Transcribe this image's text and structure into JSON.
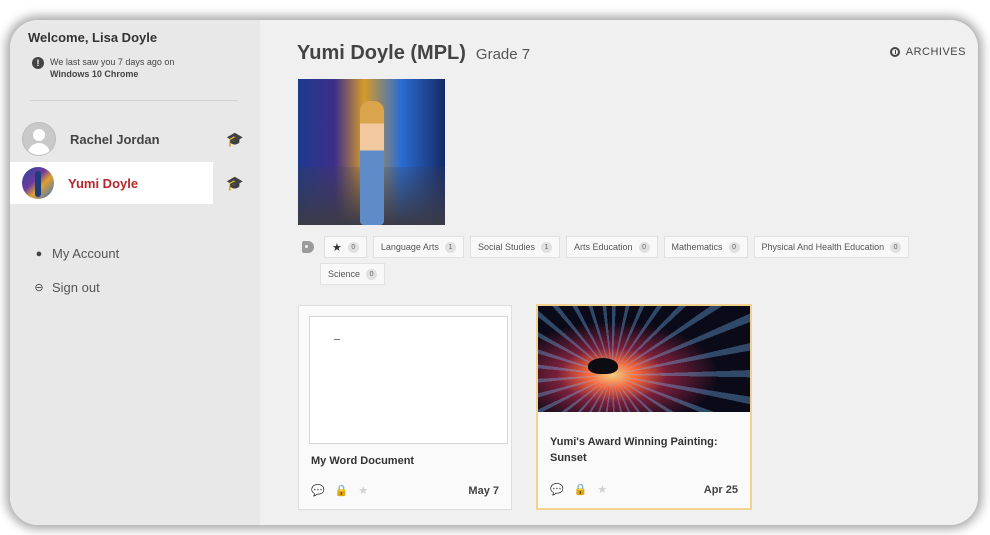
{
  "sidebar": {
    "welcome": "Welcome, Lisa Doyle",
    "last_seen_line1": "We last saw you 7 days ago on",
    "last_seen_line2": "Windows 10 Chrome",
    "students": [
      {
        "name": "Rachel Jordan",
        "icon": "graduation-cap-icon"
      },
      {
        "name": "Yumi Doyle",
        "icon": "graduation-cap-icon",
        "selected": true
      }
    ],
    "menu": [
      {
        "label": "My Account",
        "icon": "user-icon"
      },
      {
        "label": "Sign out",
        "icon": "sign-out-icon"
      }
    ]
  },
  "main": {
    "student_name": "Yumi Doyle (MPL)",
    "grade": "Grade 7",
    "archives_label": "ARCHIVES",
    "tags": [
      {
        "label": "★",
        "count": "0"
      },
      {
        "label": "Language Arts",
        "count": "1"
      },
      {
        "label": "Social Studies",
        "count": "1"
      },
      {
        "label": "Arts Education",
        "count": "0"
      },
      {
        "label": "Mathematics",
        "count": "0"
      },
      {
        "label": "Physical And Health Education",
        "count": "0"
      },
      {
        "label": "Science",
        "count": "0"
      }
    ],
    "cards": [
      {
        "title": "My Word Document",
        "date": "May 7"
      },
      {
        "title": "Yumi's Award Winning Painting: Sunset",
        "date": "Apr 25"
      }
    ]
  },
  "colors": {
    "accent_red": "#b5262b",
    "highlight_border": "#f1d28f",
    "sidebar_bg": "#e8e8e8",
    "main_bg": "#f0f0f0"
  }
}
